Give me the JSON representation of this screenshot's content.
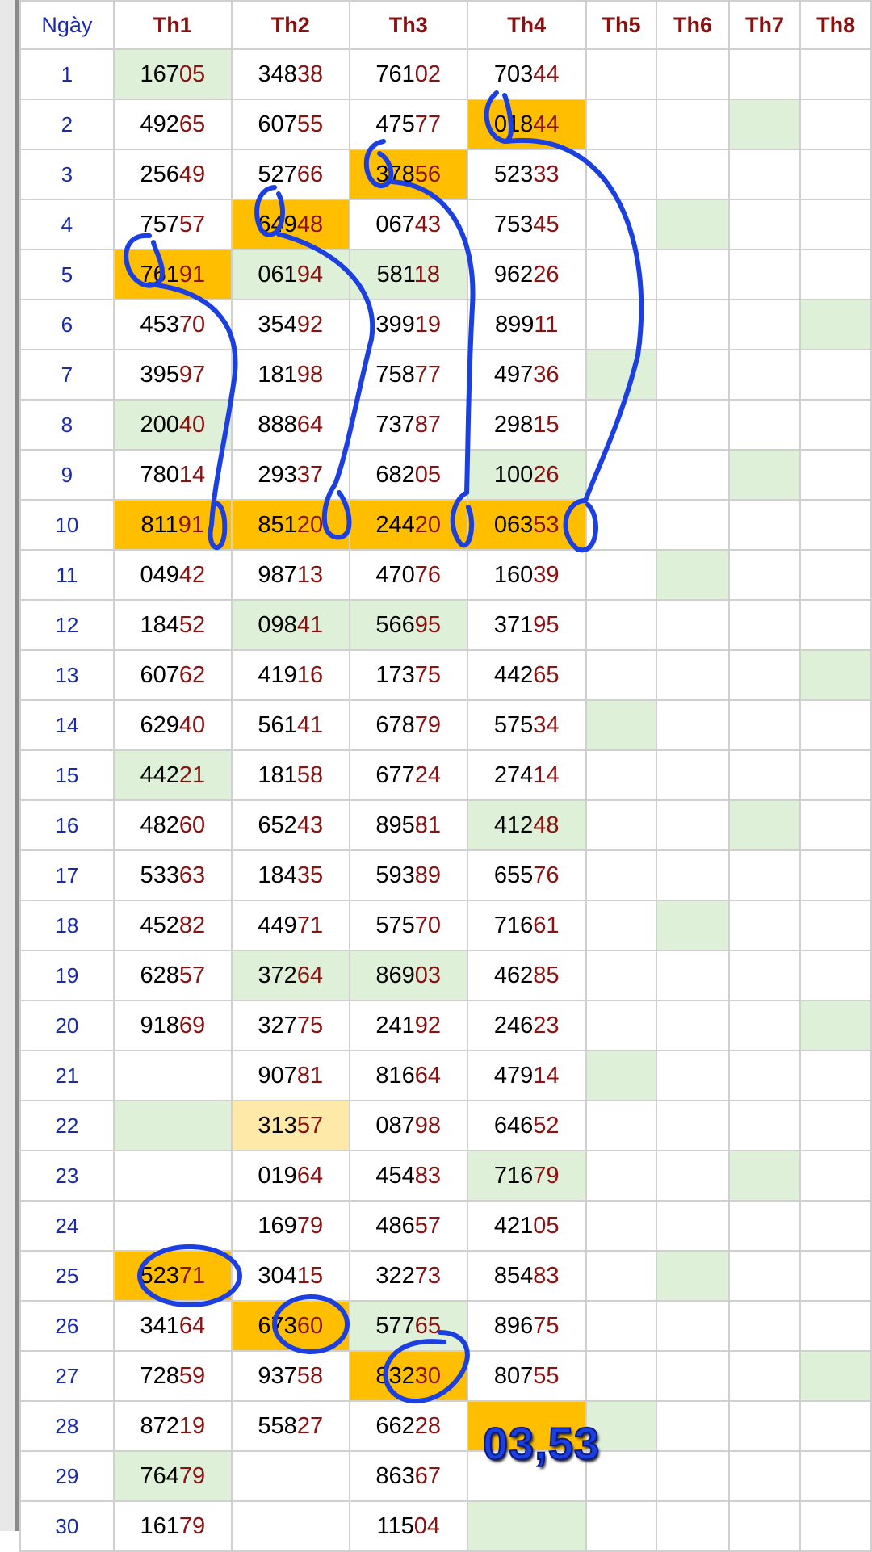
{
  "header": {
    "day_label": "Ngày",
    "months": [
      "Th1",
      "Th2",
      "Th3",
      "Th4",
      "Th5",
      "Th6",
      "Th7",
      "Th8"
    ]
  },
  "colors": {
    "green": "#dff0d8",
    "highlight_orange": "#ffbf00",
    "light_yellow": "#ffe9a8",
    "digit_red": "#8b1010",
    "ink_blue": "#1b3fe0"
  },
  "rows": [
    {
      "day": "1",
      "cells": [
        "16705",
        "34838",
        "76102",
        "70344",
        "",
        "",
        "",
        ""
      ],
      "bg": [
        "g",
        "",
        "",
        "",
        "",
        "",
        "",
        ""
      ]
    },
    {
      "day": "2",
      "cells": [
        "49265",
        "60755",
        "47577",
        "01844",
        "",
        "",
        "",
        ""
      ],
      "bg": [
        "",
        "",
        "",
        "o",
        "",
        "",
        "g",
        ""
      ]
    },
    {
      "day": "3",
      "cells": [
        "25649",
        "52766",
        "37856",
        "52333",
        "",
        "",
        "",
        ""
      ],
      "bg": [
        "",
        "",
        "o",
        "",
        "",
        "",
        "",
        ""
      ]
    },
    {
      "day": "4",
      "cells": [
        "75757",
        "64948",
        "06743",
        "75345",
        "",
        "",
        "",
        ""
      ],
      "bg": [
        "",
        "o",
        "",
        "",
        "",
        "g",
        "",
        ""
      ]
    },
    {
      "day": "5",
      "cells": [
        "76191",
        "06194",
        "58118",
        "96226",
        "",
        "",
        "",
        ""
      ],
      "bg": [
        "o",
        "g",
        "g",
        "",
        "",
        "",
        "",
        ""
      ]
    },
    {
      "day": "6",
      "cells": [
        "45370",
        "35492",
        "39919",
        "89911",
        "",
        "",
        "",
        ""
      ],
      "bg": [
        "",
        "",
        "",
        "",
        "",
        "",
        "",
        "g"
      ]
    },
    {
      "day": "7",
      "cells": [
        "39597",
        "18198",
        "75877",
        "49736",
        "",
        "",
        "",
        ""
      ],
      "bg": [
        "",
        "",
        "",
        "",
        "g",
        "",
        "",
        ""
      ]
    },
    {
      "day": "8",
      "cells": [
        "20040",
        "88864",
        "73787",
        "29815",
        "",
        "",
        "",
        ""
      ],
      "bg": [
        "g",
        "",
        "",
        "",
        "",
        "",
        "",
        ""
      ]
    },
    {
      "day": "9",
      "cells": [
        "78014",
        "29337",
        "68205",
        "10026",
        "",
        "",
        "",
        ""
      ],
      "bg": [
        "",
        "",
        "",
        "g",
        "",
        "",
        "g",
        ""
      ]
    },
    {
      "day": "10",
      "cells": [
        "81191",
        "85120",
        "24420",
        "06353",
        "",
        "",
        "",
        ""
      ],
      "bg": [
        "o",
        "o",
        "o",
        "o",
        "",
        "",
        "",
        ""
      ]
    },
    {
      "day": "11",
      "cells": [
        "04942",
        "98713",
        "47076",
        "16039",
        "",
        "",
        "",
        ""
      ],
      "bg": [
        "",
        "",
        "",
        "",
        "",
        "g",
        "",
        ""
      ]
    },
    {
      "day": "12",
      "cells": [
        "18452",
        "09841",
        "56695",
        "37195",
        "",
        "",
        "",
        ""
      ],
      "bg": [
        "",
        "g",
        "g",
        "",
        "",
        "",
        "",
        ""
      ]
    },
    {
      "day": "13",
      "cells": [
        "60762",
        "41916",
        "17375",
        "44265",
        "",
        "",
        "",
        ""
      ],
      "bg": [
        "",
        "",
        "",
        "",
        "",
        "",
        "",
        "g"
      ]
    },
    {
      "day": "14",
      "cells": [
        "62940",
        "56141",
        "67879",
        "57534",
        "",
        "",
        "",
        ""
      ],
      "bg": [
        "",
        "",
        "",
        "",
        "g",
        "",
        "",
        ""
      ]
    },
    {
      "day": "15",
      "cells": [
        "44221",
        "18158",
        "67724",
        "27414",
        "",
        "",
        "",
        ""
      ],
      "bg": [
        "g",
        "",
        "",
        "",
        "",
        "",
        "",
        ""
      ]
    },
    {
      "day": "16",
      "cells": [
        "48260",
        "65243",
        "89581",
        "41248",
        "",
        "",
        "",
        ""
      ],
      "bg": [
        "",
        "",
        "",
        "g",
        "",
        "",
        "g",
        ""
      ]
    },
    {
      "day": "17",
      "cells": [
        "53363",
        "18435",
        "59389",
        "65576",
        "",
        "",
        "",
        ""
      ],
      "bg": [
        "",
        "",
        "",
        "",
        "",
        "",
        "",
        ""
      ]
    },
    {
      "day": "18",
      "cells": [
        "45282",
        "44971",
        "57570",
        "71661",
        "",
        "",
        "",
        ""
      ],
      "bg": [
        "",
        "",
        "",
        "",
        "",
        "g",
        "",
        ""
      ]
    },
    {
      "day": "19",
      "cells": [
        "62857",
        "37264",
        "86903",
        "46285",
        "",
        "",
        "",
        ""
      ],
      "bg": [
        "",
        "g",
        "g",
        "",
        "",
        "",
        "",
        ""
      ]
    },
    {
      "day": "20",
      "cells": [
        "91869",
        "32775",
        "24192",
        "24623",
        "",
        "",
        "",
        ""
      ],
      "bg": [
        "",
        "",
        "",
        "",
        "",
        "",
        "",
        "g"
      ]
    },
    {
      "day": "21",
      "cells": [
        "",
        "90781",
        "81664",
        "47914",
        "",
        "",
        "",
        ""
      ],
      "bg": [
        "",
        "",
        "",
        "",
        "g",
        "",
        "",
        ""
      ]
    },
    {
      "day": "22",
      "cells": [
        "",
        "31357",
        "08798",
        "64652",
        "",
        "",
        "",
        ""
      ],
      "bg": [
        "g",
        "y",
        "",
        "",
        "",
        "",
        "",
        ""
      ]
    },
    {
      "day": "23",
      "cells": [
        "",
        "01964",
        "45483",
        "71679",
        "",
        "",
        "",
        ""
      ],
      "bg": [
        "",
        "",
        "",
        "g",
        "",
        "",
        "g",
        ""
      ]
    },
    {
      "day": "24",
      "cells": [
        "",
        "16979",
        "48657",
        "42105",
        "",
        "",
        "",
        ""
      ],
      "bg": [
        "",
        "",
        "",
        "",
        "",
        "",
        "",
        ""
      ]
    },
    {
      "day": "25",
      "cells": [
        "52371",
        "30415",
        "32273",
        "85483",
        "",
        "",
        "",
        ""
      ],
      "bg": [
        "o",
        "",
        "",
        "",
        "",
        "g",
        "",
        ""
      ]
    },
    {
      "day": "26",
      "cells": [
        "34164",
        "67360",
        "57765",
        "89675",
        "",
        "",
        "",
        ""
      ],
      "bg": [
        "",
        "o",
        "g",
        "",
        "",
        "",
        "",
        ""
      ]
    },
    {
      "day": "27",
      "cells": [
        "72859",
        "93758",
        "83230",
        "80755",
        "",
        "",
        "",
        ""
      ],
      "bg": [
        "",
        "",
        "o",
        "",
        "",
        "",
        "",
        "g"
      ]
    },
    {
      "day": "28",
      "cells": [
        "87219",
        "55827",
        "66228",
        "",
        "",
        "",
        "",
        ""
      ],
      "bg": [
        "",
        "",
        "",
        "o",
        "g",
        "",
        "",
        ""
      ]
    },
    {
      "day": "29",
      "cells": [
        "76479",
        "",
        "86367",
        "",
        "",
        "",
        "",
        ""
      ],
      "bg": [
        "g",
        "",
        "",
        "",
        "",
        "",
        "",
        ""
      ]
    },
    {
      "day": "30",
      "cells": [
        "16179",
        "",
        "11504",
        "",
        "",
        "",
        "",
        ""
      ],
      "bg": [
        "",
        "",
        "",
        "g",
        "",
        "",
        "",
        ""
      ]
    }
  ],
  "annotation": {
    "result_text": "03,53"
  }
}
